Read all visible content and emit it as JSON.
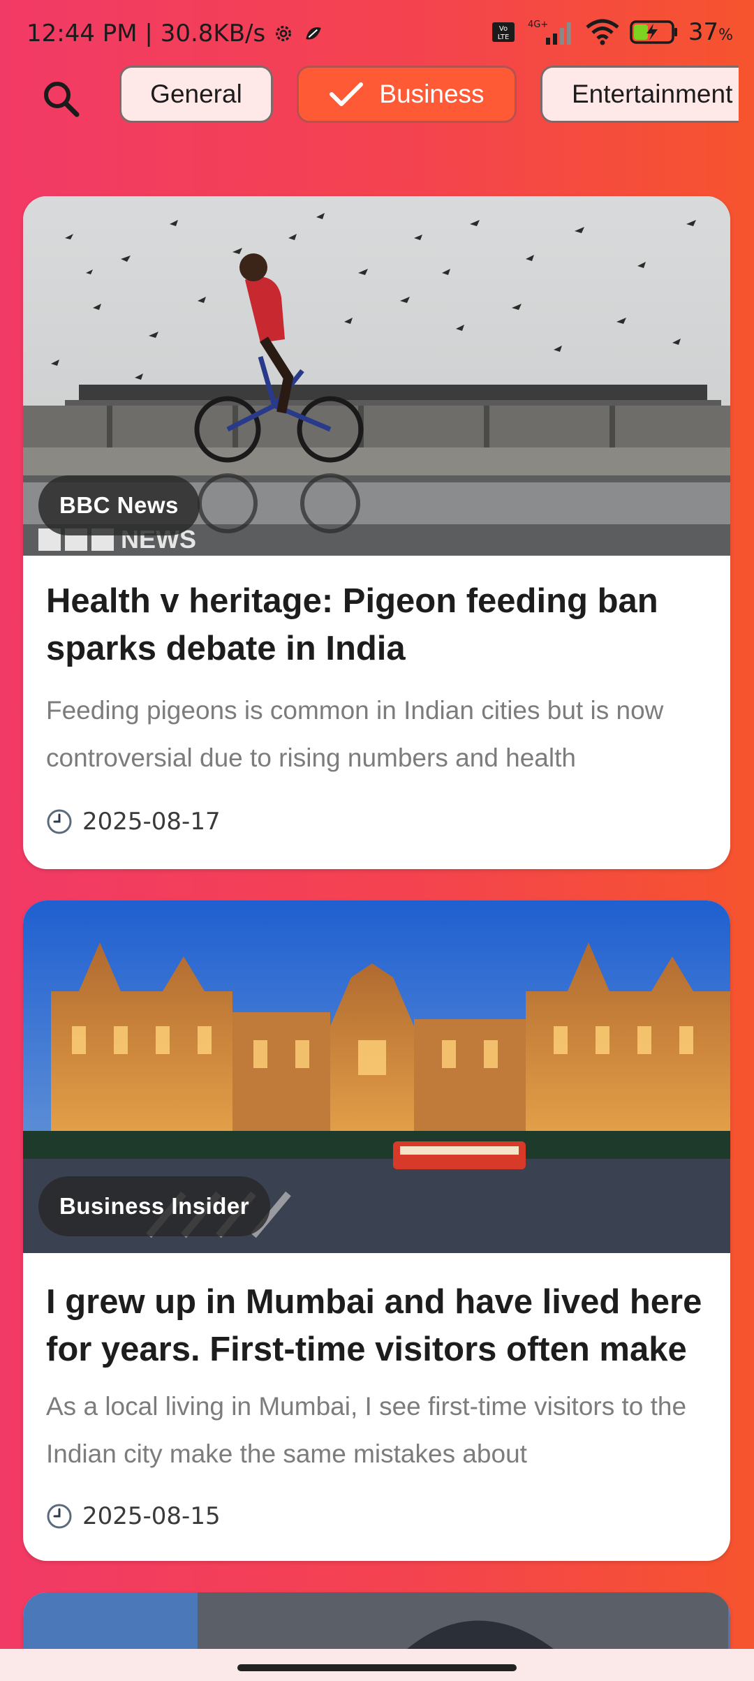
{
  "status": {
    "time_speed": "12:44 PM | 30.8KB/s",
    "network": "4G+",
    "volte": "Vo LTE",
    "battery": "37"
  },
  "categories": [
    {
      "label": "General",
      "selected": false
    },
    {
      "label": "Business",
      "selected": true
    },
    {
      "label": "Entertainment",
      "selected": false
    }
  ],
  "articles": [
    {
      "source": "BBC News",
      "title": "Health v heritage: Pigeon feeding ban sparks debate in India",
      "description": "Feeding pigeons is common in Indian cities but is now controversial due to rising numbers and health",
      "date": "2025-08-17",
      "image_watermark": "BBC NEWS"
    },
    {
      "source": "Business Insider",
      "title": "I grew up in Mumbai and have lived here for years. First-time visitors often make",
      "description": "As a local living in Mumbai, I see first-time visitors to the Indian city make the same mistakes about",
      "date": "2025-08-15"
    }
  ],
  "colors": {
    "accent": "#ff5a36",
    "chip_bg": "#ffe9e8",
    "bg_left": "#f23a66",
    "bg_right": "#f6542e"
  },
  "icons": {
    "search": "search-icon",
    "check": "check-icon",
    "clock": "clock-icon"
  }
}
